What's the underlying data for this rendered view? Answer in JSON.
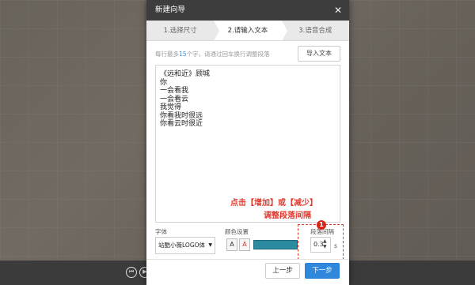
{
  "dialog": {
    "title": "新建向导",
    "close_icon": "close-icon"
  },
  "steps": [
    {
      "label": "1.选择尺寸"
    },
    {
      "label": "2.请输入文本"
    },
    {
      "label": "3.语音合成"
    }
  ],
  "hint": {
    "prefix": "每行最多",
    "number": "15",
    "suffix": "个字，请通过回车换行调整段落"
  },
  "import_button": "导入文本",
  "editor": {
    "lines": [
      "《远和近》顾城",
      "你",
      "一会看我",
      "一会看云",
      "我觉得",
      "你看我时很远",
      "你看云时很近"
    ]
  },
  "annotation": {
    "line1": "点击【增加】或【减少】",
    "line2": "调整段落间隔",
    "badge": "1",
    "color": "#e23b2e"
  },
  "controls": {
    "font_label": "字体",
    "font_value": "站酷小薇LOGO体",
    "color_label": "颜色设置",
    "swatch_color": "#2a8aa0",
    "spacing_label": "段落间隔",
    "spacing_value": "0.3",
    "spacing_unit": "s"
  },
  "footer": {
    "prev_label": "上一步",
    "next_label": "下一步"
  }
}
